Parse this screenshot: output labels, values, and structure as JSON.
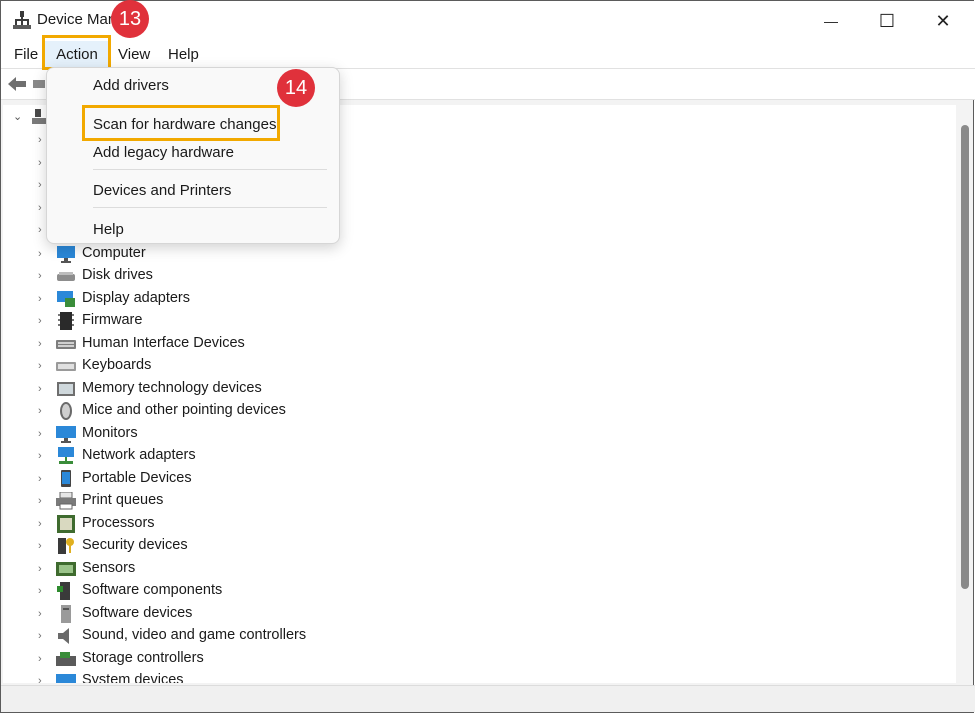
{
  "window": {
    "title": "Device Mar",
    "minimize_glyph": "—",
    "maximize_glyph": "☐",
    "close_glyph": "✕"
  },
  "menubar": {
    "items": [
      {
        "label": "File"
      },
      {
        "label": "Action"
      },
      {
        "label": "View"
      },
      {
        "label": "Help"
      }
    ]
  },
  "action_menu": {
    "items": [
      {
        "label": "Add drivers"
      },
      {
        "label": "Scan for hardware changes"
      },
      {
        "label": "Add legacy hardware"
      },
      {
        "label": "Devices and Printers"
      },
      {
        "label": "Help"
      }
    ]
  },
  "annotations": {
    "step_a": "13",
    "step_b": "14",
    "highlight_color": "#f2a900",
    "badge_color": "#e0313b"
  },
  "tree": {
    "devices": [
      {
        "label": "Computer",
        "icon": "computer-icon"
      },
      {
        "label": "Disk drives",
        "icon": "disk-drive-icon"
      },
      {
        "label": "Display adapters",
        "icon": "display-adapter-icon"
      },
      {
        "label": "Firmware",
        "icon": "firmware-icon"
      },
      {
        "label": "Human Interface Devices",
        "icon": "hid-icon"
      },
      {
        "label": "Keyboards",
        "icon": "keyboard-icon"
      },
      {
        "label": "Memory technology devices",
        "icon": "memory-icon"
      },
      {
        "label": "Mice and other pointing devices",
        "icon": "mouse-icon"
      },
      {
        "label": "Monitors",
        "icon": "monitor-icon"
      },
      {
        "label": "Network adapters",
        "icon": "network-icon"
      },
      {
        "label": "Portable Devices",
        "icon": "portable-device-icon"
      },
      {
        "label": "Print queues",
        "icon": "printer-icon"
      },
      {
        "label": "Processors",
        "icon": "processor-icon"
      },
      {
        "label": "Security devices",
        "icon": "security-device-icon"
      },
      {
        "label": "Sensors",
        "icon": "sensor-icon"
      },
      {
        "label": "Software components",
        "icon": "software-component-icon"
      },
      {
        "label": "Software devices",
        "icon": "software-device-icon"
      },
      {
        "label": "Sound, video and game controllers",
        "icon": "sound-icon"
      },
      {
        "label": "Storage controllers",
        "icon": "storage-controller-icon"
      },
      {
        "label": "System devices",
        "icon": "system-device-icon"
      }
    ]
  }
}
